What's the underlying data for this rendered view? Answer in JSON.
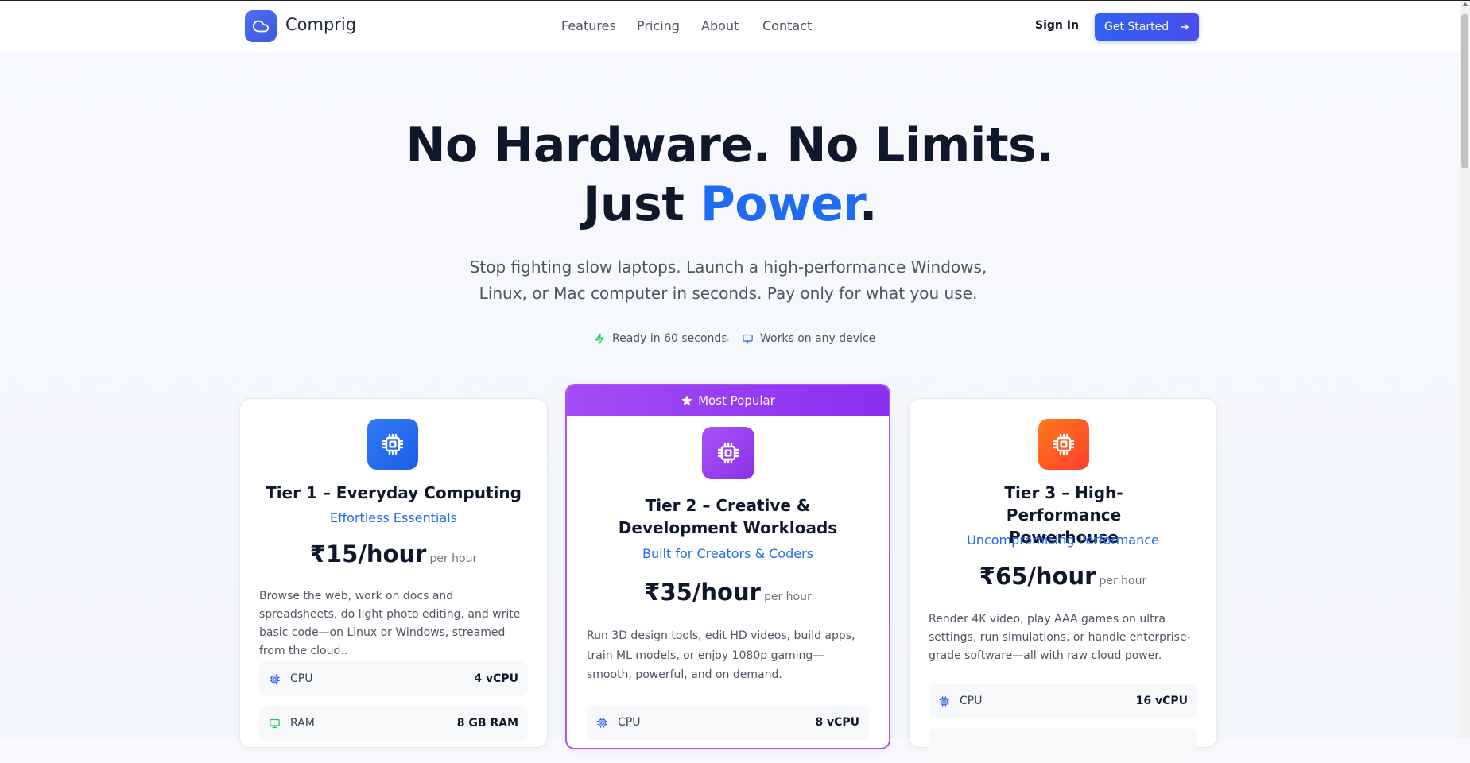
{
  "brand": {
    "name": "Comprig",
    "logo_icon": "cloud-icon"
  },
  "nav": [
    "Features",
    "Pricing",
    "About",
    "Contact"
  ],
  "header_actions": {
    "sign_in": "Sign In",
    "get_started": "Get Started"
  },
  "hero": {
    "line1": "No Hardware. No Limits.",
    "line2_prefix": "Just ",
    "line2_accent": "Power",
    "line2_suffix": ".",
    "subtitle": "Stop fighting slow laptops. Launch a high-performance Windows, Linux, or Mac computer in seconds. Pay only for what you use.",
    "features": [
      {
        "icon": "lightning-icon",
        "text": "Ready in 60 seconds"
      },
      {
        "icon": "monitor-icon",
        "text": "Works on any device"
      }
    ]
  },
  "colors": {
    "accent": "#1f6cf0",
    "popular": "#a855f7",
    "orange": "#ff4d2e",
    "green": "#22c55e"
  },
  "tiers": [
    {
      "title": "Tier 1 – Everyday Computing",
      "tagline": "Effortless Essentials",
      "price": "₹15/hour",
      "per": "per hour",
      "description": "Browse the web, work on docs and spreadsheets, do light photo editing, and write basic code—on Linux or Windows, streamed from the cloud..",
      "specs": [
        {
          "icon": "cpu-icon",
          "label": "CPU",
          "value": "4 vCPU"
        },
        {
          "icon": "monitor-icon",
          "label": "RAM",
          "value": "8 GB RAM"
        }
      ]
    },
    {
      "badge": "Most Popular",
      "title": "Tier 2 – Creative & Development Workloads",
      "tagline": "Built for Creators & Coders",
      "price": "₹35/hour",
      "per": "per hour",
      "description": "Run 3D design tools, edit HD videos, build apps, train ML models, or enjoy 1080p gaming—smooth, powerful, and on demand.",
      "specs": [
        {
          "icon": "cpu-icon",
          "label": "CPU",
          "value": "8 vCPU"
        }
      ]
    },
    {
      "title": "Tier 3 – High-Performance Powerhouse",
      "tagline": "Uncompromising Performance",
      "price": "₹65/hour",
      "per": "per hour",
      "description": "Render 4K video, play AAA games on ultra settings, run simulations, or handle enterprise-grade software—all with raw cloud power.",
      "specs": [
        {
          "icon": "cpu-icon",
          "label": "CPU",
          "value": "16 vCPU"
        }
      ]
    }
  ]
}
